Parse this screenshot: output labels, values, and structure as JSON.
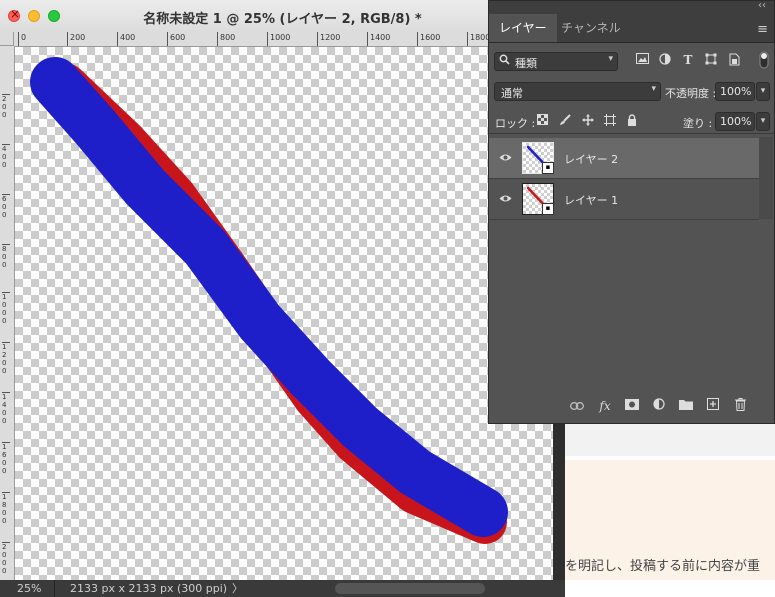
{
  "document": {
    "title": "名称未設定 1 @ 25% (レイヤー 2, RGB/8) *",
    "ruler_top": [
      "0",
      "200",
      "400",
      "600",
      "800",
      "1000",
      "1200",
      "1400",
      "1600",
      "1800"
    ],
    "ruler_left": [
      "2\n0\n0",
      "4\n0\n0",
      "6\n0\n0",
      "8\n0\n0",
      "1\n0\n0\n0",
      "1\n2\n0\n0",
      "1\n4\n0\n0",
      "1\n6\n0\n0",
      "1\n8\n0\n0",
      "2\n0\n0\n0"
    ],
    "status": {
      "zoom": "25%",
      "info": "2133 px x 2133 px (300 ppi)",
      "arrow": "〉"
    },
    "strokes": {
      "layer1_color": "#c8151c",
      "layer2_color": "#1f1fc9"
    }
  },
  "background_page": {
    "text": "を明記し、投稿する前に内容が重"
  },
  "layers_panel": {
    "collapse_glyph": "‹‹",
    "tabs": [
      {
        "label": "レイヤー",
        "active": true
      },
      {
        "label": "チャンネル",
        "active": false
      }
    ],
    "menu_glyph": "≡",
    "filter": {
      "label": "種類",
      "search_glyph": "🔍",
      "chevron": "⌄"
    },
    "filter_icons": [
      "image-filter-icon",
      "adjustment-filter-icon",
      "type-filter-icon",
      "shape-filter-icon",
      "smartobject-filter-icon"
    ],
    "blend_mode": "通常",
    "opacity_label": "不透明度 :",
    "opacity_value": "100%",
    "lock_label": "ロック :",
    "fill_label": "塗り :",
    "fill_value": "100%",
    "layers": [
      {
        "name": "レイヤー 2",
        "selected": true,
        "stroke_color": "#1f1fc9"
      },
      {
        "name": "レイヤー 1",
        "selected": false,
        "stroke_color": "#c8151c"
      }
    ],
    "bottom_icons": [
      "link-icon",
      "fx-icon",
      "mask-icon",
      "adjustment-icon",
      "folder-icon",
      "new-layer-icon",
      "trash-icon"
    ]
  }
}
